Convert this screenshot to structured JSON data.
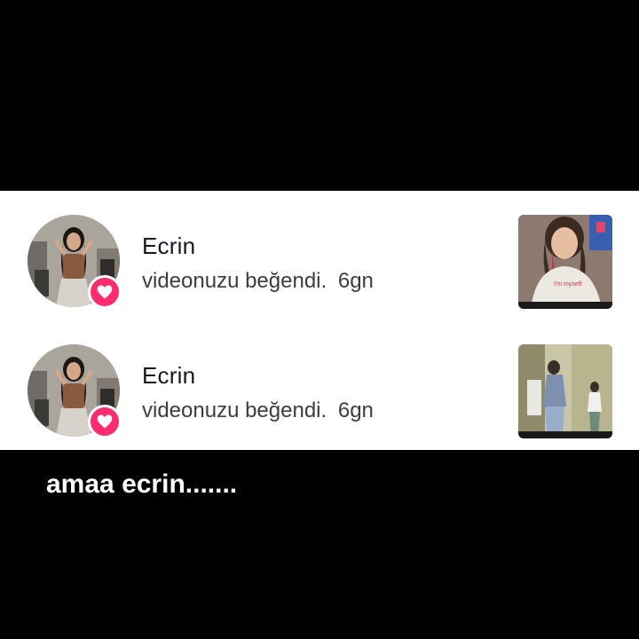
{
  "notifications": [
    {
      "username": "Ecrin",
      "action": "videonuzu beğendi.",
      "time": "6gn",
      "avatar_icon": "profile-photo",
      "badge_icon": "heart-icon",
      "thumbnail": "video-thumbnail"
    },
    {
      "username": "Ecrin",
      "action": "videonuzu beğendi.",
      "time": "6gn",
      "avatar_icon": "profile-photo",
      "badge_icon": "heart-icon",
      "thumbnail": "video-thumbnail"
    }
  ],
  "caption": "amaa ecrin.......",
  "colors": {
    "background": "#000000",
    "panel": "#ffffff",
    "like_badge": "#ff2d6f",
    "text_primary": "#161823",
    "text_secondary": "#3b3c44"
  }
}
